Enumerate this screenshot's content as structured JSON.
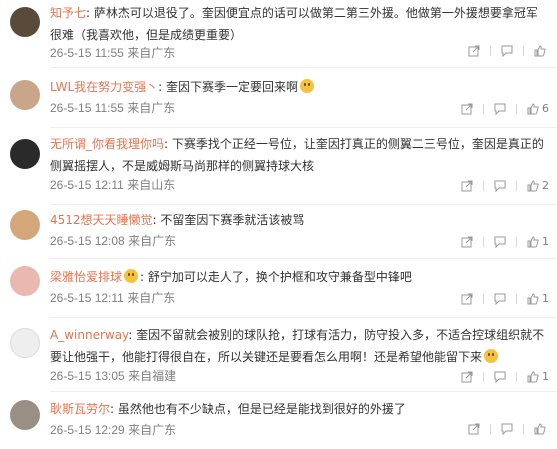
{
  "comments": [
    {
      "username": "知予七",
      "text": "萨林杰可以退役了。奎因便宜点的话可以做第二第三外援。他做第一外援想要拿冠军很难（我喜欢他，但是成绩更重要）",
      "emoji": "",
      "time": "26-5-15 11:55",
      "location": "来自广东",
      "likes": "",
      "avatar_color": "#5a4a3a"
    },
    {
      "username": "LWL我在努力变强丶",
      "text": "奎因下赛季一定要回来啊",
      "emoji": "smile",
      "time": "26-5-15 11:55",
      "location": "来自广东",
      "likes": "6",
      "avatar_color": "#c9a58a"
    },
    {
      "username": "无所谓_你看我理你吗",
      "text": "下赛季找个正经一号位，让奎因打真正的侧翼二三号位，奎因是真正的侧翼摇摆人，不是威姆斯马尚那样的侧翼持球大核",
      "emoji": "",
      "time": "26-5-15 12:11",
      "location": "来自山东",
      "likes": "2",
      "avatar_color": "#2a2a2a"
    },
    {
      "username": "4512想天天睡懒觉",
      "text": "不留奎因下赛季就活该被骂",
      "emoji": "",
      "time": "26-5-15 12:08",
      "location": "来自广东",
      "likes": "1",
      "avatar_color": "#d4a77a"
    },
    {
      "username": "梁雅怡爱排球",
      "text": "舒宁加可以走人了，换个护框和攻守兼备型中锋吧",
      "emoji": "",
      "time": "26-5-15 12:11",
      "location": "来自广东",
      "likes": "1",
      "avatar_color": "#e9b8b0"
    },
    {
      "username": "A_winnerway",
      "text": "奎因不留就会被别的球队抢，打球有活力，防守投入多，不适合控球组织就不要让他强干，他能打得很自在，所以关键还是要看怎么用啊！还是希望他能留下来",
      "emoji": "cry",
      "time": "26-5-15 13:05",
      "location": "来自福建",
      "likes": "1",
      "avatar_color": "#eeeeee"
    },
    {
      "username": "耿斯瓦劳尔",
      "text": "虽然他也有不少缺点，但是已经是能找到很好的外援了",
      "emoji": "",
      "time": "26-5-15 12:29",
      "location": "来自广东",
      "likes": "",
      "avatar_color": "#9a8f85"
    }
  ]
}
